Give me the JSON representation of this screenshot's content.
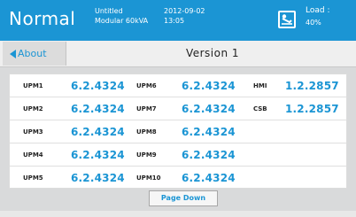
{
  "header": {
    "mode": "Normal",
    "device_name": "Untitled",
    "device_model": "Modular 60kVA",
    "date": "2012-09-02",
    "time": "13:05",
    "load_label": "Load :",
    "load_value": "40%",
    "icon": "schedule-icon",
    "accent_color": "#1b95d4"
  },
  "nav": {
    "back_label": "About",
    "back_icon": "chevron-left-icon",
    "title": "Version 1"
  },
  "versions": {
    "rows": [
      [
        {
          "label": "UPM1",
          "value": "6.2.4324"
        },
        {
          "label": "UPM6",
          "value": "6.2.4324"
        },
        {
          "label": "HMI",
          "value": "1.2.2857"
        }
      ],
      [
        {
          "label": "UPM2",
          "value": "6.2.4324"
        },
        {
          "label": "UPM7",
          "value": "6.2.4324"
        },
        {
          "label": "CSB",
          "value": "1.2.2857"
        }
      ],
      [
        {
          "label": "UPM3",
          "value": "6.2.4324"
        },
        {
          "label": "UPM8",
          "value": "6.2.4324"
        }
      ],
      [
        {
          "label": "UPM4",
          "value": "6.2.4324"
        },
        {
          "label": "UPM9",
          "value": "6.2.4324"
        }
      ],
      [
        {
          "label": "UPM5",
          "value": "6.2.4324"
        },
        {
          "label": "UPM10",
          "value": "6.2.4324"
        }
      ]
    ]
  },
  "actions": {
    "page_down_label": "Page Down"
  }
}
